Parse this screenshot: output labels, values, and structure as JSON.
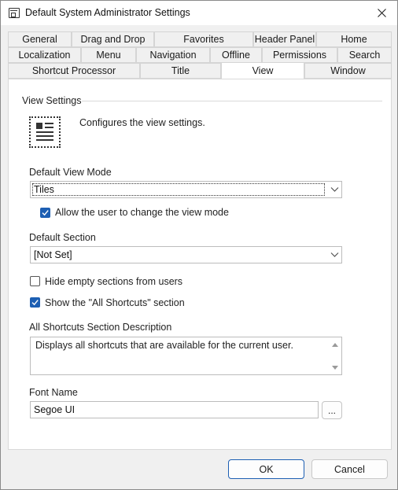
{
  "window": {
    "title": "Default System Administrator Settings"
  },
  "icons": {
    "app": "window-settings-icon",
    "close": "close-icon",
    "view": "view-layout-icon",
    "check": "checkmark-icon",
    "dropdown": "chevron-down-icon"
  },
  "tabs": {
    "row1": [
      "General",
      "Drag and Drop",
      "Favorites",
      "Header Panel",
      "Home"
    ],
    "row2": [
      "Localization",
      "Menu",
      "Navigation",
      "Offline",
      "Permissions",
      "Search"
    ],
    "row3": [
      "Shortcut Processor",
      "Title",
      "View",
      "Window"
    ],
    "active": "View"
  },
  "view_settings": {
    "group_label": "View Settings",
    "description": "Configures the view settings.",
    "default_view_mode": {
      "label": "Default View Mode",
      "value": "Tiles"
    },
    "allow_change_view_mode": {
      "label": "Allow the user to change the view mode",
      "checked": true
    },
    "default_section": {
      "label": "Default Section",
      "value": "[Not Set]"
    },
    "hide_empty_sections": {
      "label": "Hide empty sections from users",
      "checked": false
    },
    "show_all_shortcuts": {
      "label": "Show the \"All Shortcuts\" section",
      "checked": true
    },
    "all_shortcuts_description": {
      "label": "All Shortcuts Section Description",
      "value": "Displays all shortcuts that are available for the current user."
    },
    "font_name": {
      "label": "Font Name",
      "value": "Segoe UI",
      "browse_label": "..."
    }
  },
  "buttons": {
    "ok": "OK",
    "cancel": "Cancel"
  },
  "colors": {
    "accent": "#1d5fb3",
    "window_bg": "#f0f0f0",
    "panel_bg": "#ffffff"
  }
}
